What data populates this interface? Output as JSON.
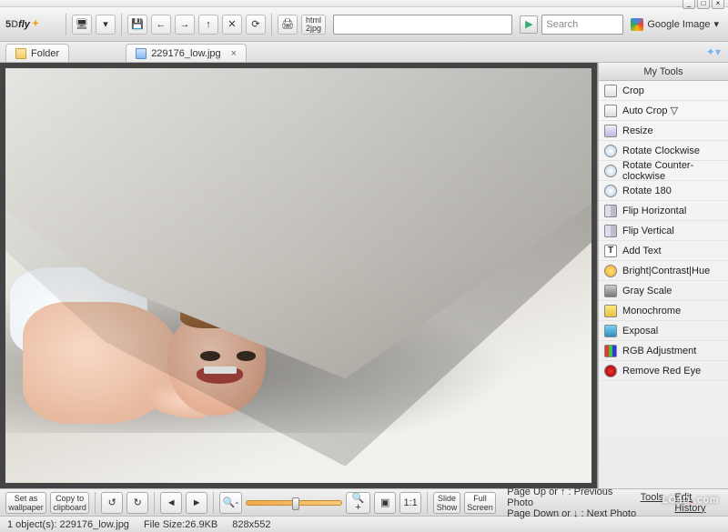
{
  "app": {
    "name": "5Dfly"
  },
  "window": {
    "minimize": "_",
    "maximize": "□",
    "close": "×"
  },
  "toolbar": {
    "html2jpg": "html\n2jpg",
    "search_placeholder": "Search",
    "engine": "Google Image"
  },
  "tabs": {
    "folder": "Folder",
    "file": "229176_low.jpg"
  },
  "sidepanel": {
    "title": "My Tools",
    "tools": [
      {
        "label": "Crop",
        "cls": "crop"
      },
      {
        "label": "Auto Crop ▽",
        "cls": "crop"
      },
      {
        "label": "Resize",
        "cls": "resize"
      },
      {
        "label": "Rotate Clockwise",
        "cls": "rotate"
      },
      {
        "label": "Rotate Counter-clockwise",
        "cls": "rotate"
      },
      {
        "label": "Rotate 180",
        "cls": "rotate"
      },
      {
        "label": "Flip Horizontal",
        "cls": "flip"
      },
      {
        "label": "Flip Vertical",
        "cls": "flip"
      },
      {
        "label": "Add Text",
        "cls": "text"
      },
      {
        "label": "Bright|Contrast|Hue",
        "cls": "bright"
      },
      {
        "label": "Gray Scale",
        "cls": "gray"
      },
      {
        "label": "Monochrome",
        "cls": "mono"
      },
      {
        "label": "Exposal",
        "cls": "expo"
      },
      {
        "label": "RGB Adjustment",
        "cls": "rgb"
      },
      {
        "label": "Remove Red Eye",
        "cls": "redeye"
      }
    ]
  },
  "bottombar": {
    "set_wallpaper": "Set as\nwallpaper",
    "copy_clipboard": "Copy to\nclipboard",
    "slide_show": "Slide\nShow",
    "full_screen": "Full\nScreen",
    "hint_up": "Page Up or ↑ : Previous Photo",
    "hint_down": "Page Down or ↓ : Next Photo",
    "link_tools": "Tools",
    "link_history": "Edit History"
  },
  "status": {
    "objects": "1 object(s): 229176_low.jpg",
    "filesize": "File Size:26.9KB",
    "dims": "828x552"
  },
  "watermark": {
    "text": "LO4D",
    "suffix": ".com"
  }
}
